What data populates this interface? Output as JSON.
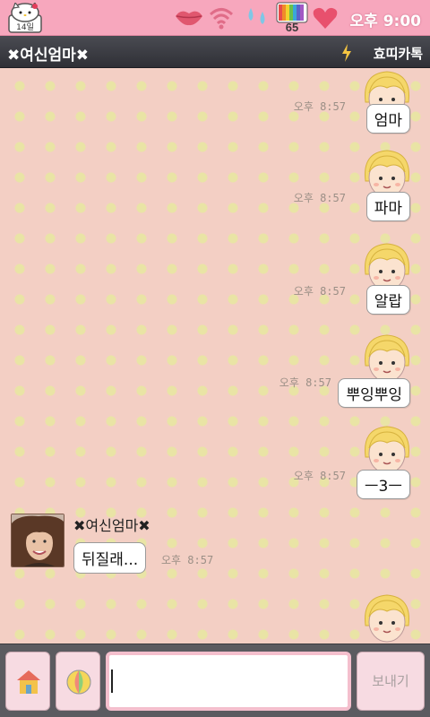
{
  "status_bar": {
    "date_badge": "14일",
    "battery": "65",
    "clock": "오후 9:00",
    "icons": [
      "hello-kitty-calendar-icon",
      "lips-icon",
      "wifi-icon",
      "signal-drops-icon",
      "battery-icon",
      "heart-icon"
    ]
  },
  "title_bar": {
    "chat_title": "✖여신엄마✖",
    "right_label": "효띠카톡"
  },
  "messages": [
    {
      "sender": "me",
      "text": "엄마",
      "time": "오후 8:57"
    },
    {
      "sender": "me",
      "text": "파마",
      "time": "오후 8:57"
    },
    {
      "sender": "me",
      "text": "알랍",
      "time": "오후 8:57"
    },
    {
      "sender": "me",
      "text": "뿌잉뿌잉",
      "time": "오후 8:57"
    },
    {
      "sender": "me",
      "text": "ㅡ3ㅡ",
      "time": "오후 8:57"
    },
    {
      "sender": "friend",
      "name": "✖여신엄마✖",
      "text": "뒤질래...",
      "time": "오후 8:57"
    }
  ],
  "input_bar": {
    "placeholder": "",
    "send_label": "보내기"
  },
  "colors": {
    "status_bar_bg": "#f7a7bd",
    "title_bar_bg": "#3a3b41",
    "chat_bg": "#f3cfc4",
    "dot": "#e9e4a5"
  }
}
